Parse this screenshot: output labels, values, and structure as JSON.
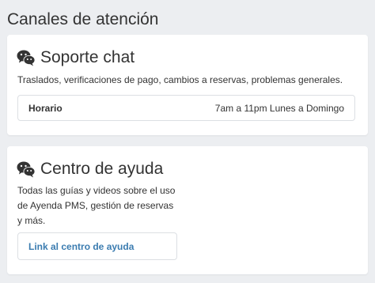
{
  "page": {
    "title": "Canales de atención"
  },
  "chat_card": {
    "icon": "wechat-icon",
    "title": "Soporte chat",
    "description": "Traslados, verificaciones de pago, cambios a reservas, problemas generales.",
    "schedule": {
      "label": "Horario",
      "value": "7am a 11pm Lunes a Domingo"
    }
  },
  "help_card": {
    "icon": "wechat-icon",
    "title": "Centro de ayuda",
    "description": "Todas las guías y videos sobre el uso de Ayenda PMS, gestión de reservas y más.",
    "link_label": "Link al centro de ayuda"
  },
  "colors": {
    "background": "#eceef1",
    "card": "#ffffff",
    "text": "#333333",
    "link": "#3b7cb0",
    "border": "#dcdfe3"
  }
}
